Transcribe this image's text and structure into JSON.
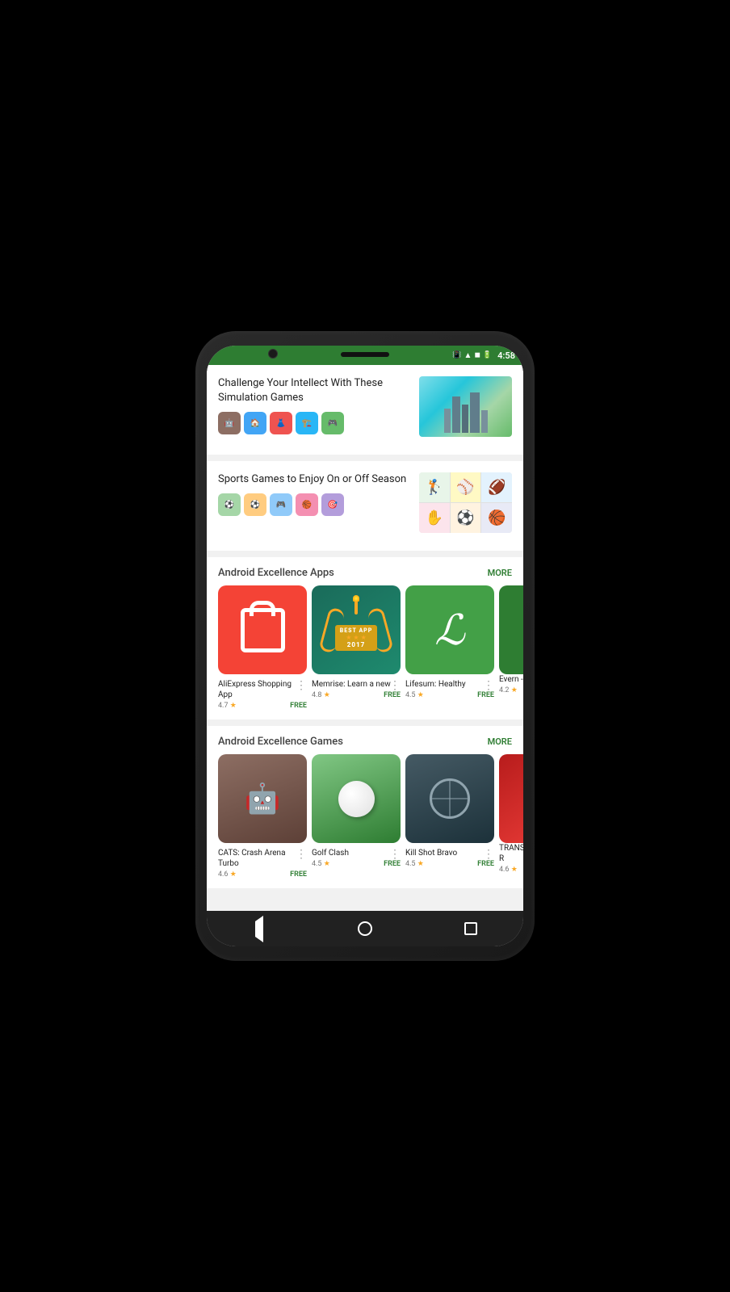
{
  "status_bar": {
    "time": "4:58",
    "bg_color": "#2e7d32"
  },
  "sections": {
    "sim_games": {
      "title": "Challenge Your Intellect With These Simulation Games"
    },
    "sports_games": {
      "title": "Sports Games to Enjoy On or Off Season"
    },
    "excellence_apps": {
      "title": "Android Excellence Apps",
      "more_label": "MORE",
      "apps": [
        {
          "name": "AliExpress Shopping App",
          "rating": "4.7",
          "price": "FREE",
          "icon_type": "aliexpress"
        },
        {
          "name": "Memrise: Learn a new",
          "rating": "4.8",
          "price": "FREE",
          "icon_type": "memrise",
          "badge_best": "BEST APP",
          "badge_year": "2017"
        },
        {
          "name": "Lifesum: Healthy",
          "rating": "4.5",
          "price": "FREE",
          "icon_type": "lifesum"
        },
        {
          "name": "Evern - stay",
          "rating": "4.2",
          "price": "",
          "icon_type": "evernote",
          "partial": true
        }
      ]
    },
    "excellence_games": {
      "title": "Android Excellence Games",
      "more_label": "MORE",
      "games": [
        {
          "name": "CATS: Crash Arena Turbo",
          "rating": "4.6",
          "price": "FREE",
          "icon_type": "cats"
        },
        {
          "name": "Golf Clash",
          "rating": "4.5",
          "price": "FREE",
          "icon_type": "golf"
        },
        {
          "name": "Kill Shot Bravo",
          "rating": "4.5",
          "price": "FREE",
          "icon_type": "kill"
        },
        {
          "name": "TRANSFORMERS: R",
          "rating": "4.6",
          "price": "",
          "icon_type": "transformers",
          "partial": true
        }
      ]
    }
  },
  "nav": {
    "back_label": "◁",
    "home_label": "○",
    "recents_label": "□"
  },
  "stars": "★"
}
